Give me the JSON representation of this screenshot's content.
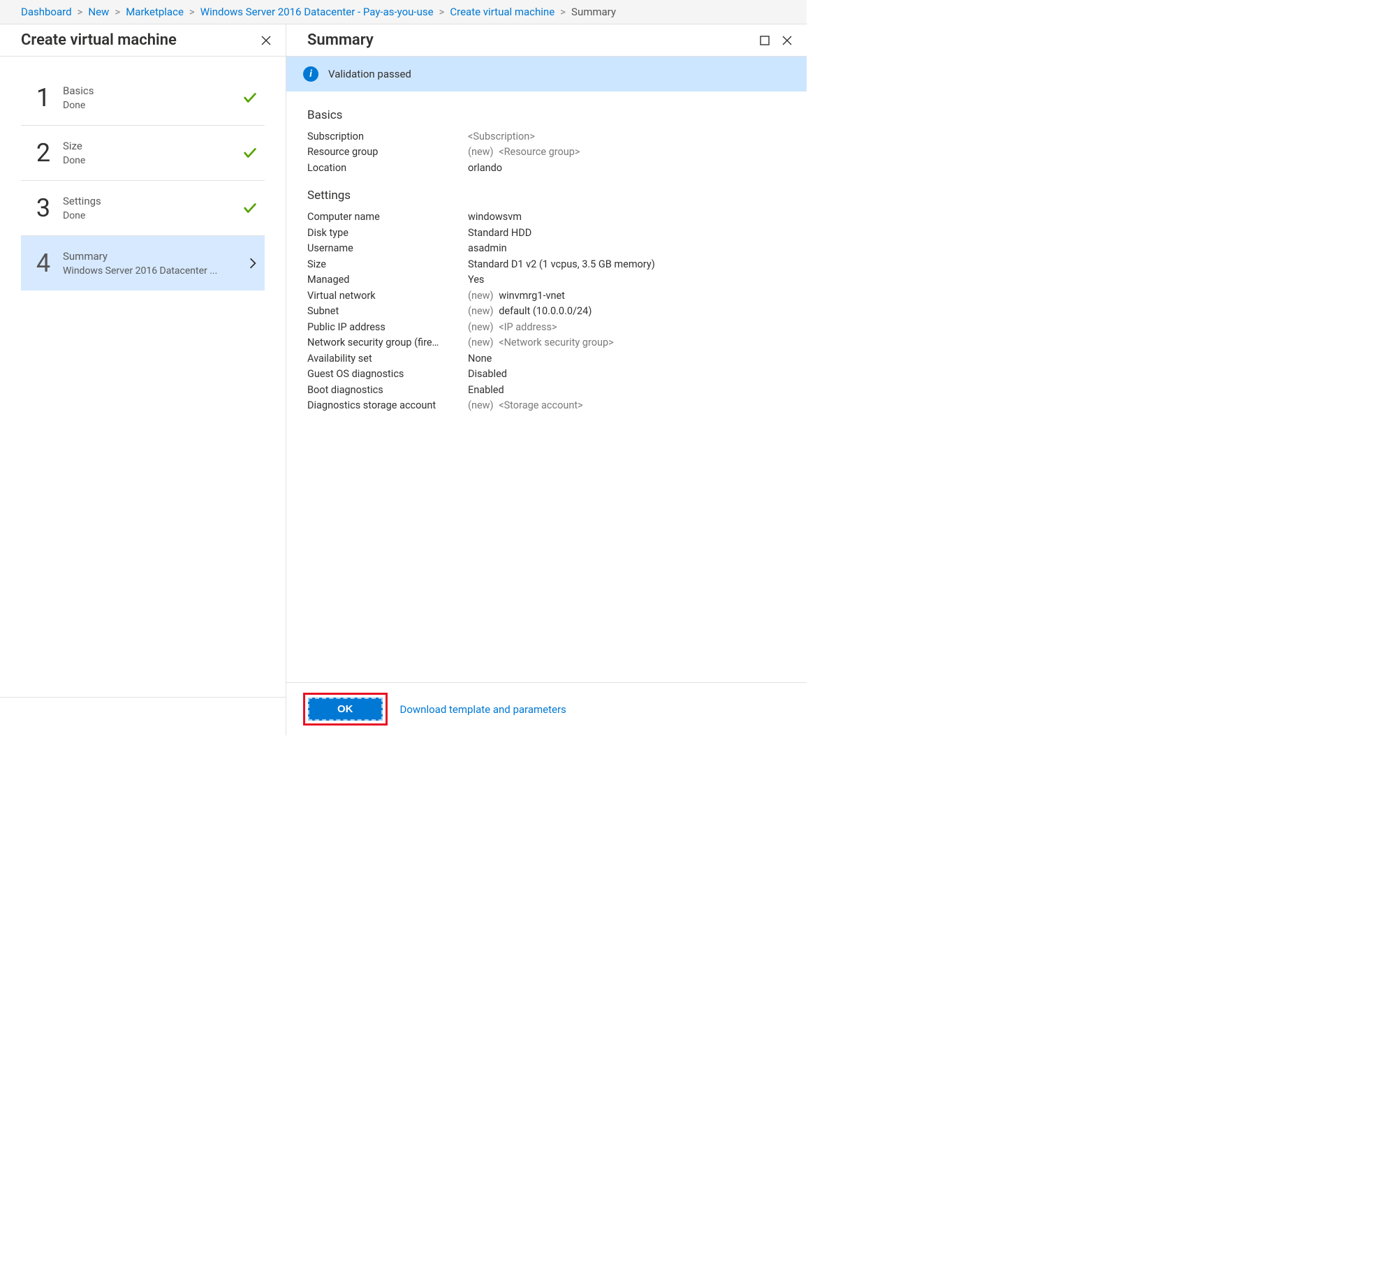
{
  "breadcrumb": [
    {
      "label": "Dashboard",
      "link": true
    },
    {
      "label": "New",
      "link": true
    },
    {
      "label": "Marketplace",
      "link": true
    },
    {
      "label": "Windows Server 2016 Datacenter - Pay-as-you-use",
      "link": true
    },
    {
      "label": "Create virtual machine",
      "link": true
    },
    {
      "label": "Summary",
      "link": false
    }
  ],
  "leftPanel": {
    "title": "Create virtual machine",
    "steps": [
      {
        "num": "1",
        "title": "Basics",
        "status": "Done",
        "checked": true,
        "active": false
      },
      {
        "num": "2",
        "title": "Size",
        "status": "Done",
        "checked": true,
        "active": false
      },
      {
        "num": "3",
        "title": "Settings",
        "status": "Done",
        "checked": true,
        "active": false
      },
      {
        "num": "4",
        "title": "Summary",
        "status": "Windows Server 2016 Datacenter ...",
        "checked": false,
        "active": true
      }
    ]
  },
  "rightPanel": {
    "title": "Summary",
    "validationMessage": "Validation passed",
    "okLabel": "OK",
    "downloadLink": "Download template and parameters",
    "sections": [
      {
        "heading": "Basics",
        "rows": [
          {
            "k": "Subscription",
            "v": "<Subscription>",
            "placeholder": true
          },
          {
            "k": "Resource group",
            "v": "<Resource group>",
            "new": true,
            "placeholder": true
          },
          {
            "k": "Location",
            "v": "orlando"
          }
        ]
      },
      {
        "heading": "Settings",
        "rows": [
          {
            "k": "Computer name",
            "v": "windowsvm"
          },
          {
            "k": "Disk type",
            "v": "Standard HDD"
          },
          {
            "k": "Username",
            "v": "asadmin"
          },
          {
            "k": "Size",
            "v": "Standard D1 v2 (1 vcpus, 3.5 GB memory)"
          },
          {
            "k": "Managed",
            "v": "Yes"
          },
          {
            "k": "Virtual network",
            "v": "winvmrg1-vnet",
            "new": true
          },
          {
            "k": "Subnet",
            "v": "default (10.0.0.0/24)",
            "new": true
          },
          {
            "k": "Public IP address",
            "v": "<IP address>",
            "new": true,
            "placeholder": true
          },
          {
            "k": "Network security group (fire…",
            "v": "<Network security group>",
            "new": true,
            "placeholder": true
          },
          {
            "k": "Availability set",
            "v": "None"
          },
          {
            "k": "Guest OS diagnostics",
            "v": "Disabled"
          },
          {
            "k": "Boot diagnostics",
            "v": "Enabled"
          },
          {
            "k": "Diagnostics storage account",
            "v": "<Storage account>",
            "new": true,
            "placeholder": true
          }
        ]
      }
    ]
  }
}
